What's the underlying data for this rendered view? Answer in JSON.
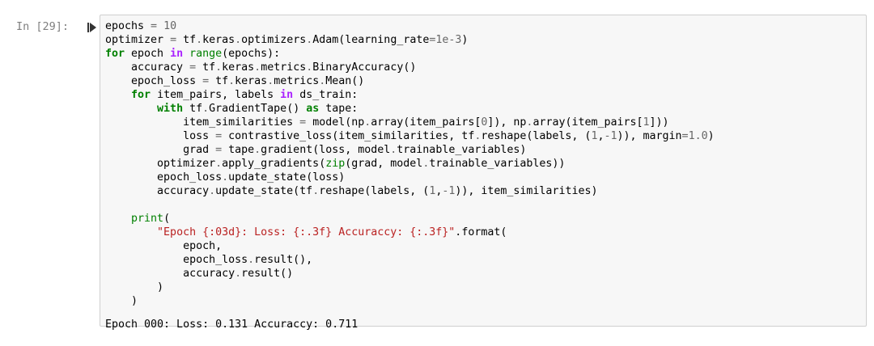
{
  "cell": {
    "prompt": "In [29]:",
    "output": "Epoch 000: Loss: 0.131 Accuraccy: 0.711"
  },
  "code_lines": [
    [
      {
        "t": "epochs "
      },
      {
        "t": "=",
        "c": "op"
      },
      {
        "t": " "
      },
      {
        "t": "10",
        "c": "num"
      }
    ],
    [
      {
        "t": "optimizer "
      },
      {
        "t": "=",
        "c": "op"
      },
      {
        "t": " tf"
      },
      {
        "t": ".",
        "c": "op"
      },
      {
        "t": "keras"
      },
      {
        "t": ".",
        "c": "op"
      },
      {
        "t": "optimizers"
      },
      {
        "t": ".",
        "c": "op"
      },
      {
        "t": "Adam(learning_rate"
      },
      {
        "t": "=",
        "c": "op"
      },
      {
        "t": "1e-3",
        "c": "num"
      },
      {
        "t": ")"
      }
    ],
    [
      {
        "t": "for",
        "c": "kw"
      },
      {
        "t": " epoch "
      },
      {
        "t": "in",
        "c": "kwo"
      },
      {
        "t": " "
      },
      {
        "t": "range",
        "c": "bi"
      },
      {
        "t": "(epochs):"
      }
    ],
    [
      {
        "t": "    accuracy "
      },
      {
        "t": "=",
        "c": "op"
      },
      {
        "t": " tf"
      },
      {
        "t": ".",
        "c": "op"
      },
      {
        "t": "keras"
      },
      {
        "t": ".",
        "c": "op"
      },
      {
        "t": "metrics"
      },
      {
        "t": ".",
        "c": "op"
      },
      {
        "t": "BinaryAccuracy()"
      }
    ],
    [
      {
        "t": "    epoch_loss "
      },
      {
        "t": "=",
        "c": "op"
      },
      {
        "t": " tf"
      },
      {
        "t": ".",
        "c": "op"
      },
      {
        "t": "keras"
      },
      {
        "t": ".",
        "c": "op"
      },
      {
        "t": "metrics"
      },
      {
        "t": ".",
        "c": "op"
      },
      {
        "t": "Mean()"
      }
    ],
    [
      {
        "t": "    "
      },
      {
        "t": "for",
        "c": "kw"
      },
      {
        "t": " item_pairs, labels "
      },
      {
        "t": "in",
        "c": "kwo"
      },
      {
        "t": " ds_train:"
      }
    ],
    [
      {
        "t": "        "
      },
      {
        "t": "with",
        "c": "kw"
      },
      {
        "t": " tf"
      },
      {
        "t": ".",
        "c": "op"
      },
      {
        "t": "GradientTape() "
      },
      {
        "t": "as",
        "c": "kw"
      },
      {
        "t": " tape:"
      }
    ],
    [
      {
        "t": "            item_similarities "
      },
      {
        "t": "=",
        "c": "op"
      },
      {
        "t": " model(np"
      },
      {
        "t": ".",
        "c": "op"
      },
      {
        "t": "array(item_pairs["
      },
      {
        "t": "0",
        "c": "num"
      },
      {
        "t": "]), np"
      },
      {
        "t": ".",
        "c": "op"
      },
      {
        "t": "array(item_pairs["
      },
      {
        "t": "1",
        "c": "num"
      },
      {
        "t": "]))"
      }
    ],
    [
      {
        "t": "            loss "
      },
      {
        "t": "=",
        "c": "op"
      },
      {
        "t": " contrastive_loss(item_similarities, tf"
      },
      {
        "t": ".",
        "c": "op"
      },
      {
        "t": "reshape(labels, ("
      },
      {
        "t": "1",
        "c": "num"
      },
      {
        "t": ","
      },
      {
        "t": "-1",
        "c": "num"
      },
      {
        "t": ")), margin"
      },
      {
        "t": "=",
        "c": "op"
      },
      {
        "t": "1.0",
        "c": "num"
      },
      {
        "t": ")"
      }
    ],
    [
      {
        "t": "            grad "
      },
      {
        "t": "=",
        "c": "op"
      },
      {
        "t": " tape"
      },
      {
        "t": ".",
        "c": "op"
      },
      {
        "t": "gradient(loss, model"
      },
      {
        "t": ".",
        "c": "op"
      },
      {
        "t": "trainable_variables)"
      }
    ],
    [
      {
        "t": "        optimizer"
      },
      {
        "t": ".",
        "c": "op"
      },
      {
        "t": "apply_gradients("
      },
      {
        "t": "zip",
        "c": "bi"
      },
      {
        "t": "(grad, model"
      },
      {
        "t": ".",
        "c": "op"
      },
      {
        "t": "trainable_variables))"
      }
    ],
    [
      {
        "t": "        epoch_loss"
      },
      {
        "t": ".",
        "c": "op"
      },
      {
        "t": "update_state(loss)"
      }
    ],
    [
      {
        "t": "        accuracy"
      },
      {
        "t": ".",
        "c": "op"
      },
      {
        "t": "update_state(tf"
      },
      {
        "t": ".",
        "c": "op"
      },
      {
        "t": "reshape(labels, ("
      },
      {
        "t": "1",
        "c": "num"
      },
      {
        "t": ","
      },
      {
        "t": "-1",
        "c": "num"
      },
      {
        "t": ")), item_similarities)"
      }
    ],
    [
      {
        "t": ""
      }
    ],
    [
      {
        "t": "    "
      },
      {
        "t": "print",
        "c": "bi"
      },
      {
        "t": "("
      }
    ],
    [
      {
        "t": "        "
      },
      {
        "t": "\"Epoch {:03d}: Loss: {:.3f} Accuraccy: {:.3f}\"",
        "c": "str"
      },
      {
        "t": "."
      },
      {
        "t": "format("
      }
    ],
    [
      {
        "t": "            epoch,"
      }
    ],
    [
      {
        "t": "            epoch_loss"
      },
      {
        "t": ".",
        "c": "op"
      },
      {
        "t": "result(),"
      }
    ],
    [
      {
        "t": "            accuracy"
      },
      {
        "t": ".",
        "c": "op"
      },
      {
        "t": "result()"
      }
    ],
    [
      {
        "t": "        )"
      }
    ],
    [
      {
        "t": "    )"
      }
    ]
  ]
}
